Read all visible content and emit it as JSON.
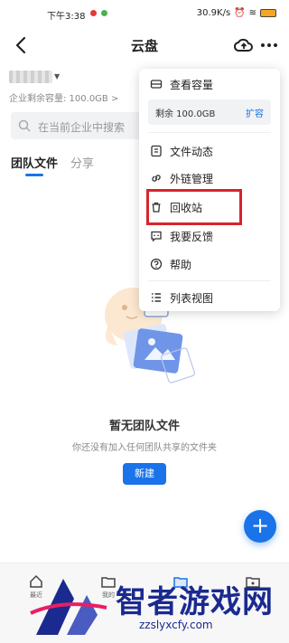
{
  "status_bar": {
    "time": "下午3:38",
    "net_speed": "30.9K/s",
    "battery": "96"
  },
  "header": {
    "title": "云盘"
  },
  "account": {
    "storage_label": "企业剩余容量: 100.0GB >"
  },
  "search": {
    "placeholder": "在当前企业中搜索"
  },
  "tabs": [
    {
      "label": "团队文件",
      "active": true
    },
    {
      "label": "分享",
      "active": false
    }
  ],
  "empty_state": {
    "title": "暂无团队文件",
    "description": "你还没有加入任何团队共享的文件夹",
    "create_label": "新建"
  },
  "fab": {
    "label": "+"
  },
  "bottom_nav": [
    {
      "label": "最近",
      "icon": "home-icon"
    },
    {
      "label": "我的",
      "icon": "folder-icon"
    },
    {
      "label": "",
      "icon": "team-folder-icon"
    },
    {
      "label": "",
      "icon": "shared-folder-icon"
    }
  ],
  "menu": {
    "view_capacity": "查看容量",
    "remaining": "剩余 100.0GB",
    "expand": "扩容",
    "file_activity": "文件动态",
    "link_management": "外链管理",
    "recycle_bin": "回收站",
    "feedback": "我要反馈",
    "help": "帮助",
    "list_view": "列表视图"
  },
  "watermark": {
    "title": "智者游戏网",
    "url": "zzslyxcfy.com"
  },
  "colors": {
    "accent": "#1a73e8",
    "highlight": "#d9232c",
    "watermark": "#1b2a8f"
  }
}
